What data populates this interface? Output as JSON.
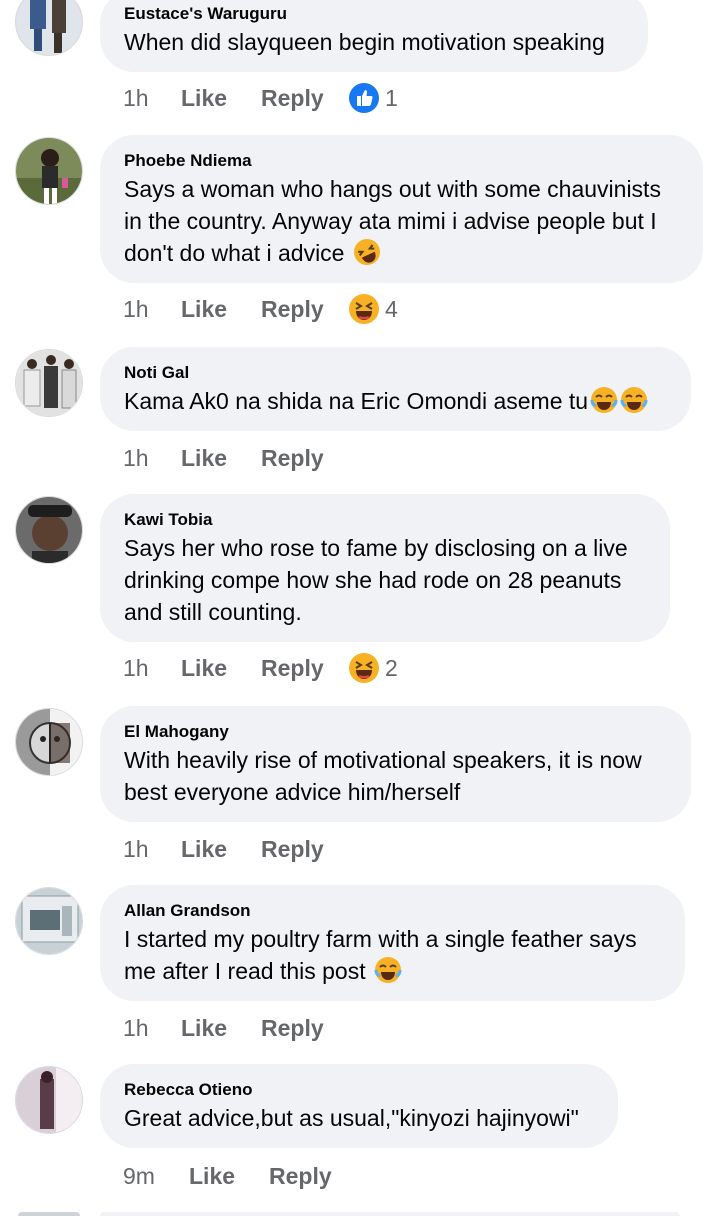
{
  "comments": [
    {
      "author": "Eustace's Waruguru",
      "text": "When did slayqueen begin motivation speaking",
      "time": "1h",
      "like": "Like",
      "reply": "Reply",
      "reaction": "like-icon",
      "reaction_count": "1"
    },
    {
      "author": "Phoebe Ndiema",
      "text": "Says a woman who hangs out with some chauvinists in the country. Anyway ata mimi i advise people but I don't do what i advice",
      "time": "1h",
      "like": "Like",
      "reply": "Reply",
      "reaction": "laughing-icon",
      "reaction_count": "4"
    },
    {
      "author": "Noti Gal",
      "text": "Kama Ak0 na shida na Eric Omondi aseme tu",
      "time": "1h",
      "like": "Like",
      "reply": "Reply"
    },
    {
      "author": "Kawi Tobia",
      "text": "Says her who rose to fame by disclosing on a live drinking compe how she had rode on 28 peanuts and still counting.",
      "time": "1h",
      "like": "Like",
      "reply": "Reply",
      "reaction": "laughing-icon",
      "reaction_count": "2"
    },
    {
      "author": "El Mahogany",
      "text": "With heavily rise of motivational speakers, it is now best everyone advice him/herself",
      "time": "1h",
      "like": "Like",
      "reply": "Reply"
    },
    {
      "author": "Allan Grandson",
      "text": "I started my poultry farm with a single feather says me after I read this post",
      "time": "1h",
      "like": "Like",
      "reply": "Reply"
    },
    {
      "author": "Rebecca Otieno",
      "text": "Great advice,but as usual,\"kinyozi hajinyowi\"",
      "time": "9m",
      "like": "Like",
      "reply": "Reply"
    }
  ],
  "colors": {
    "bubble": "#f0f2f5",
    "meta": "#65676b",
    "like_blue": "#1877f2",
    "haha_yellow": "#f7b125"
  }
}
